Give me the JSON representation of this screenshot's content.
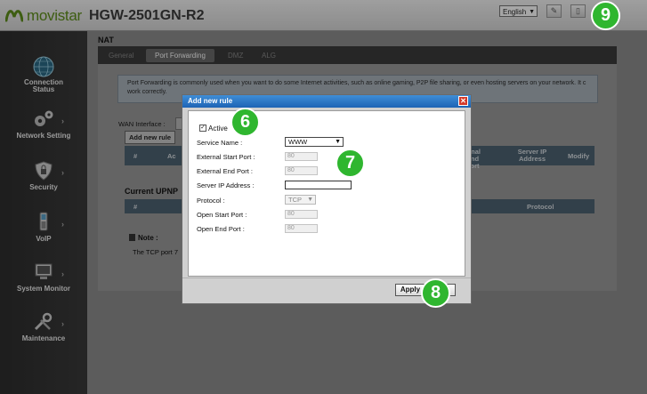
{
  "header": {
    "brand": "movistar",
    "model": "HGW-2501GN-R2",
    "language": "English"
  },
  "sidebar": {
    "items": [
      {
        "label": "Connection Status",
        "icon": "globe-icon"
      },
      {
        "label": "Network Setting",
        "icon": "gears-icon"
      },
      {
        "label": "Security",
        "icon": "shield-icon"
      },
      {
        "label": "VoIP",
        "icon": "phone-icon"
      },
      {
        "label": "System Monitor",
        "icon": "monitor-icon"
      },
      {
        "label": "Maintenance",
        "icon": "tools-icon"
      }
    ]
  },
  "page": {
    "title": "NAT",
    "tabs": [
      "General",
      "Port Forwarding",
      "DMZ",
      "ALG"
    ],
    "description": "Port Forwarding is commonly used when you want to do some Internet activities, such as online gaming, P2P file sharing, or even hosting servers on your network.  It c                                                                                                                          work correctly.",
    "wan_interface_label": "WAN Interface :",
    "add_rule_button": "Add new rule",
    "rules_columns": {
      "num": "#",
      "active": "Ac",
      "ext_end": "ernal End Port",
      "server_ip": "Server IP Address",
      "modify": "Modify"
    },
    "upnp_title": "Current UPNP",
    "upnp_columns": {
      "num": "#",
      "protocol": "Protocol"
    },
    "note_title": "Note :",
    "note_text": "The TCP port  7"
  },
  "modal": {
    "title": "Add new rule",
    "active_label": "Active",
    "active_checked": true,
    "fields": [
      {
        "label": "Service Name :",
        "value": "WWW",
        "kind": "select"
      },
      {
        "label": "External Start Port :",
        "value": "80",
        "kind": "input-disabled"
      },
      {
        "label": "External End Port :",
        "value": "80",
        "kind": "input-disabled"
      },
      {
        "label": "Server IP Address :",
        "value": "",
        "kind": "input"
      },
      {
        "label": "Protocol :",
        "value": "TCP",
        "kind": "select-disabled"
      },
      {
        "label": "Open Start Port :",
        "value": "80",
        "kind": "input-disabled"
      },
      {
        "label": "Open End Port :",
        "value": "80",
        "kind": "input-disabled"
      }
    ],
    "apply_label": "Apply"
  },
  "badges": {
    "active": "6",
    "fields": "7",
    "apply": "8",
    "top": "9"
  },
  "colors": {
    "brand_green": "#5f8f1b",
    "badge_green": "#2fb62f",
    "titlebar_blue": "#1d63b5",
    "close_red": "#d43a2a"
  }
}
